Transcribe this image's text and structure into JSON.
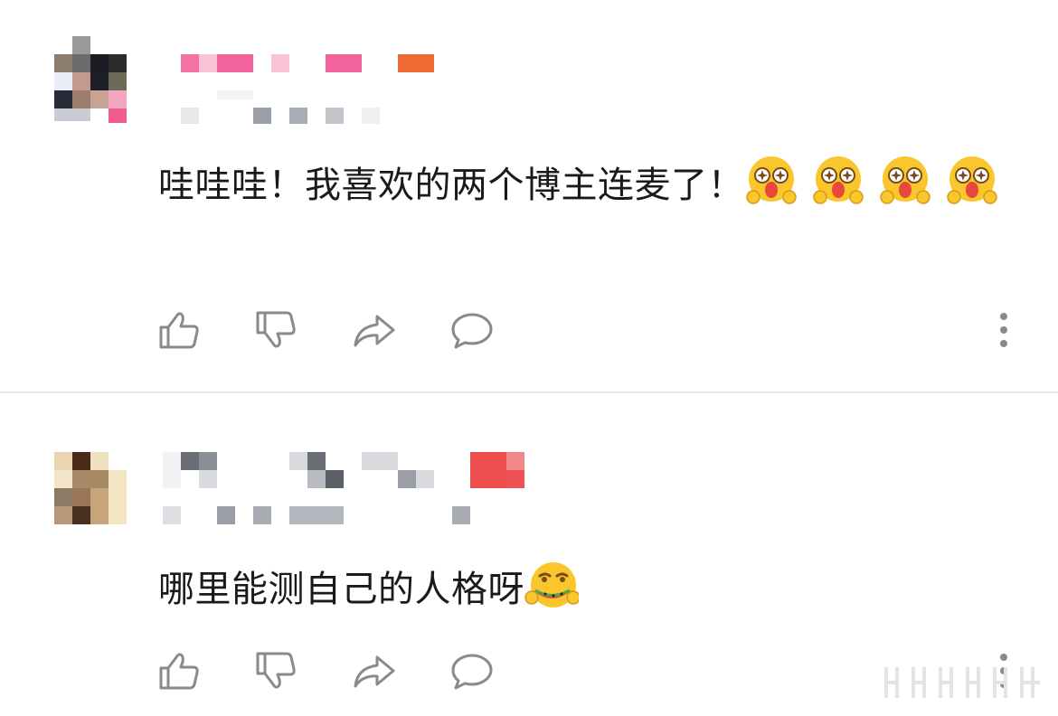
{
  "comments": [
    {
      "username": "",
      "text": "哇哇哇！我喜欢的两个博主连麦了！",
      "emoji": [
        {
          "icon": "starry-eyes-emoji-icon"
        },
        {
          "icon": "starry-eyes-emoji-icon"
        },
        {
          "icon": "starry-eyes-emoji-icon"
        },
        {
          "icon": "starry-eyes-emoji-icon"
        }
      ],
      "actions": [
        {
          "icon": "thumbs-up-icon"
        },
        {
          "icon": "thumbs-down-icon"
        },
        {
          "icon": "share-arrow-icon"
        },
        {
          "icon": "comment-bubble-icon"
        },
        {
          "icon": "more-vertical-icon"
        }
      ]
    },
    {
      "username": "",
      "text": "哪里能测自己的人格呀",
      "emoji": [
        {
          "icon": "watermelon-eating-emoji-icon"
        }
      ],
      "actions": [
        {
          "icon": "thumbs-up-icon"
        },
        {
          "icon": "thumbs-down-icon"
        },
        {
          "icon": "share-arrow-icon"
        },
        {
          "icon": "comment-bubble-icon"
        },
        {
          "icon": "more-vertical-icon"
        }
      ]
    }
  ],
  "colors": {
    "text": "#1a1a1a",
    "icon": "#8a8a8a",
    "divider": "#e6e6e6",
    "emoji_face": "#f9c62c",
    "emoji_mouth": "#e8483c"
  }
}
